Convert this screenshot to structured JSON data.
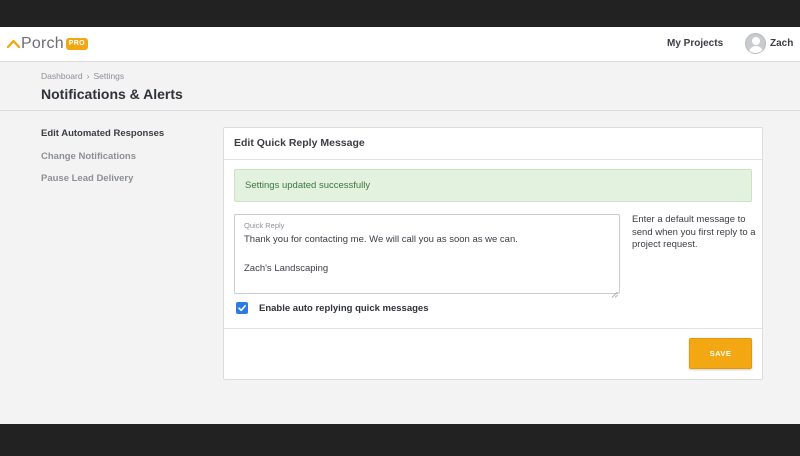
{
  "colors": {
    "brand_orange": "#f3a712",
    "checkbox_blue": "#2c7be5",
    "success_bg": "#e3f1df",
    "success_text": "#3c763d"
  },
  "header": {
    "logo_text": "Porch",
    "logo_badge": "PRO",
    "nav_link": "My Projects",
    "user_name": "Zach",
    "avatar_icon": "user-avatar-icon"
  },
  "breadcrumb": {
    "items": [
      "Dashboard",
      "Settings"
    ],
    "separator": "›"
  },
  "page": {
    "title": "Notifications & Alerts"
  },
  "sidebar": {
    "items": [
      {
        "label": "Edit Automated Responses",
        "active": true
      },
      {
        "label": "Change Notifications",
        "active": false
      },
      {
        "label": "Pause Lead Delivery",
        "active": false
      }
    ]
  },
  "card": {
    "title": "Edit Quick Reply Message",
    "alert": "Settings updated successfully",
    "quick_reply": {
      "label": "Quick Reply",
      "value": "Thank you for contacting me. We will call you as soon as we can.\n\nZach's Landscaping"
    },
    "help_text": "Enter a default message to send when you first reply to a project request.",
    "checkbox": {
      "label": "Enable auto replying quick messages",
      "checked": true
    },
    "save_label": "SAVE"
  }
}
